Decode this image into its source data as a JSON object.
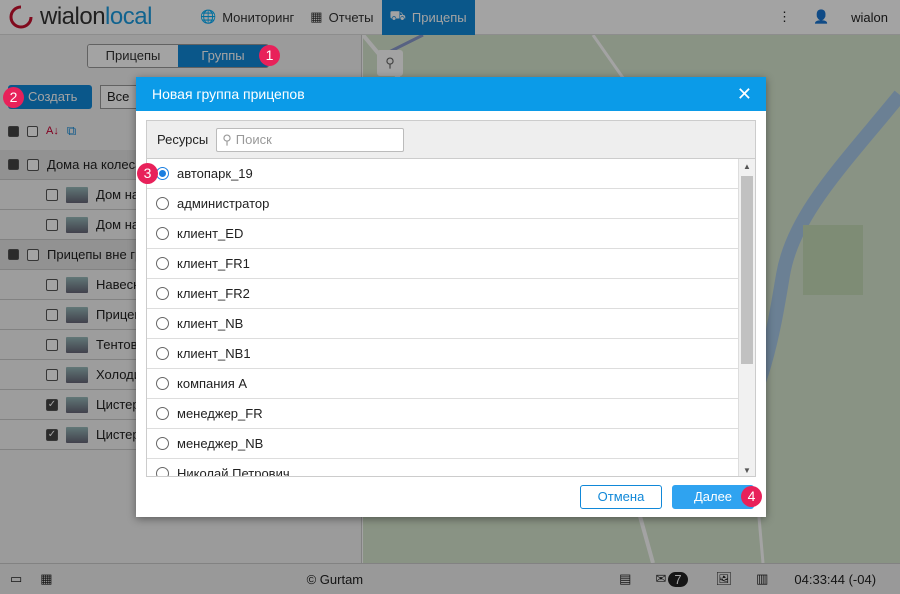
{
  "header": {
    "logo": "wialon local",
    "nav": [
      {
        "label": "Мониторинг",
        "icon": "globe-icon"
      },
      {
        "label": "Отчеты",
        "icon": "report-icon"
      },
      {
        "label": "Прицепы",
        "icon": "trailer-icon",
        "active": true
      }
    ],
    "user": "wialon"
  },
  "sidebar": {
    "tabs": [
      "Прицепы",
      "Группы"
    ],
    "create_label": "Создать",
    "filter_value": "Все",
    "groups": [
      {
        "name": "Дома на колесах",
        "items": [
          {
            "name": "Дом на",
            "checked": false
          },
          {
            "name": "Дом на",
            "checked": false
          }
        ]
      },
      {
        "name": "Прицепы вне гру",
        "items": [
          {
            "name": "Навесн",
            "checked": false
          },
          {
            "name": "Прицеп",
            "checked": false
          },
          {
            "name": "Тентов",
            "checked": false
          },
          {
            "name": "Холоди",
            "checked": false
          },
          {
            "name": "Цистер",
            "checked": true
          },
          {
            "name": "Цистер",
            "checked": true
          }
        ]
      }
    ]
  },
  "dialog": {
    "title": "Новая группа прицепов",
    "resources_label": "Ресурсы",
    "search_placeholder": "Поиск",
    "resources": [
      "автопарк_19",
      "администратор",
      "клиент_ED",
      "клиент_FR1",
      "клиент_FR2",
      "клиент_NB",
      "клиент_NB1",
      "компания А",
      "менеджер_FR",
      "менеджер_NB",
      "Николай Петрович"
    ],
    "selected": 0,
    "cancel_label": "Отмена",
    "next_label": "Далее"
  },
  "badges": [
    "1",
    "2",
    "3",
    "4"
  ],
  "footer": {
    "copyright": "© Gurtam",
    "messages_count": "7",
    "time": "04:33:44 (-04)"
  },
  "colors": {
    "accent": "#1188d8",
    "dialog_header": "#0b9be8",
    "badge": "#e8215a"
  }
}
